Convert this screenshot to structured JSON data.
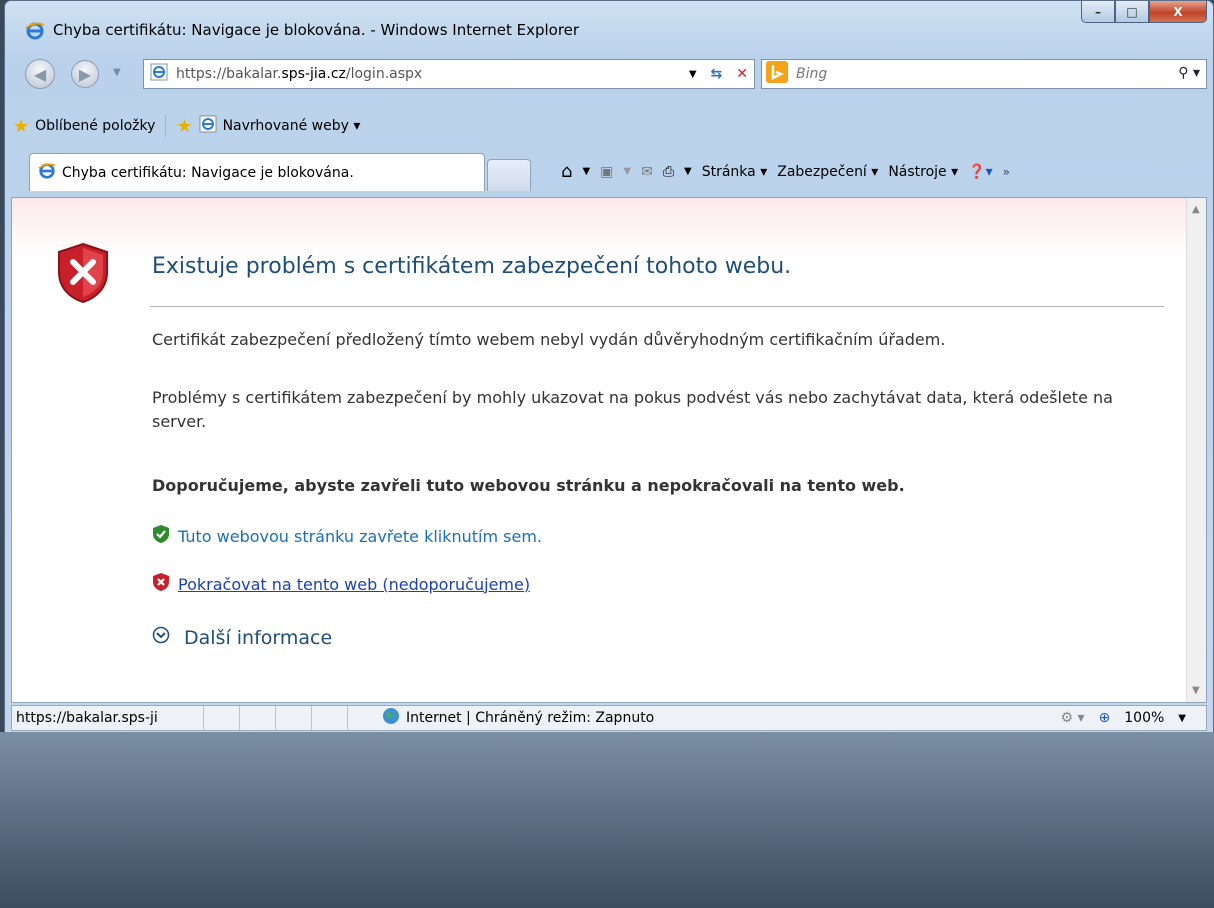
{
  "window": {
    "title": "Chyba certifikátu: Navigace je blokována. - Windows Internet Explorer",
    "buttons": {
      "minimize": "–",
      "maximize": "□",
      "close": "X"
    }
  },
  "address_bar": {
    "url_prefix": "https://bakalar.",
    "url_domain": "sps-jia.cz",
    "url_suffix": "/login.aspx",
    "search_placeholder": "Bing"
  },
  "favorites_bar": {
    "favorites_label": "Oblíbené položky",
    "suggested_label": "Navrhované weby ▾"
  },
  "tab": {
    "label": "Chyba certifikátu: Navigace je blokována."
  },
  "command_bar": {
    "page_label": "Stránka ▾",
    "security_label": "Zabezpečení ▾",
    "tools_label": "Nástroje ▾"
  },
  "content": {
    "heading": "Existuje problém s certifikátem zabezpečení tohoto webu.",
    "paragraph1": "Certifikát zabezpečení předložený tímto webem nebyl vydán důvěryhodným certifikačním úřadem.",
    "paragraph2": "Problémy s certifikátem zabezpečení by mohly ukazovat na pokus podvést vás nebo zachytávat data, která odešlete na server.",
    "recommendation": "Doporučujeme, abyste zavřeli tuto webovou stránku a nepokračovali na tento web.",
    "close_link": "Tuto webovou stránku zavřete kliknutím sem.",
    "continue_link": "Pokračovat na tento web (nedoporučujeme)",
    "more_info": "Další informace"
  },
  "status_bar": {
    "url": "https://bakalar.sps-ji",
    "zone": "Internet | Chráněný režim: Zapnuto",
    "zoom": "100%"
  },
  "colors": {
    "heading": "#1f4e79",
    "link": "#1c6fb5",
    "shield_red": "#c8202a",
    "shield_green": "#2e8b2e"
  }
}
